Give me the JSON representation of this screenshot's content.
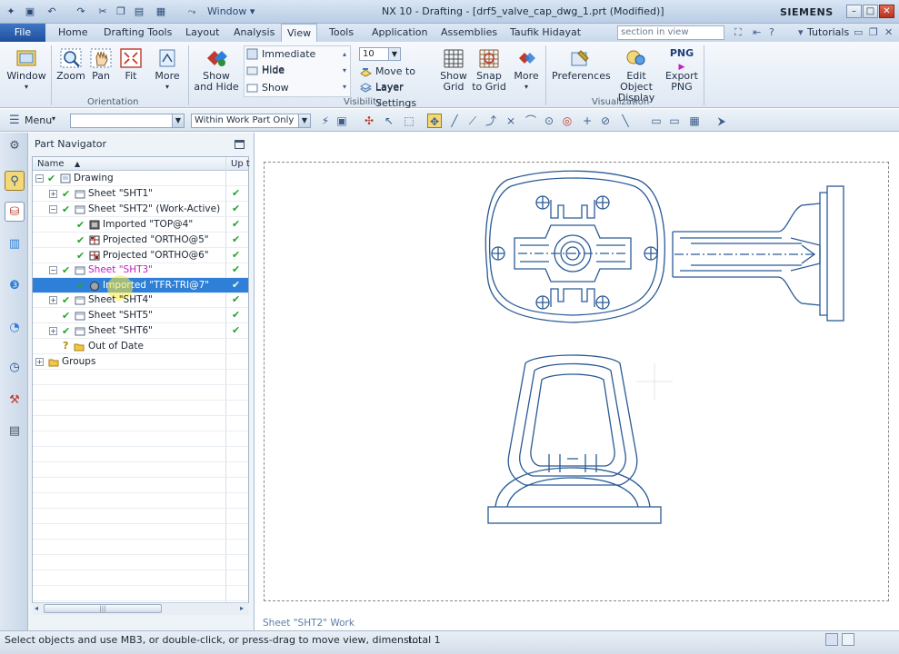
{
  "window": {
    "title": "NX 10 - Drafting - [drf5_valve_cap_dwg_1.prt (Modified)]",
    "brand": "SIEMENS",
    "quick_access_window_label": "Window"
  },
  "tabs": [
    "File",
    "Home",
    "Drafting Tools",
    "Layout",
    "Analysis",
    "View",
    "Tools",
    "Application",
    "Assemblies",
    "Taufik Hidayat"
  ],
  "active_tab": "View",
  "search_placeholder": "section in view",
  "tutorials_label": "Tutorials",
  "ribbon": {
    "window_label": "Window",
    "orientation": {
      "label": "Orientation",
      "zoom": "Zoom",
      "pan": "Pan",
      "fit": "Fit",
      "more": "More"
    },
    "visibility": {
      "label": "Visibility",
      "show_and_hide": "Show and Hide",
      "immediate_hide": "Immediate Hide",
      "hide": "Hide",
      "show": "Show",
      "layer_value": "10",
      "move_to_layer": "Move to Layer",
      "layer_settings": "Layer Settings",
      "show_grid": "Show Grid",
      "snap_to_grid": "Snap to Grid",
      "more": "More"
    },
    "visualization": {
      "label": "Visualization",
      "preferences": "Preferences",
      "edit_object_display": "Edit Object Display",
      "export_png": "Export PNG",
      "png_badge": "PNG"
    }
  },
  "toolbar2": {
    "menu_label": "Menu",
    "filter_value": "",
    "scope_value": "Within Work Part Only"
  },
  "navigator": {
    "title": "Part Navigator",
    "columns": {
      "name": "Name",
      "up": "Up t"
    },
    "rows": [
      {
        "label": "Drawing"
      },
      {
        "label": "Sheet \"SHT1\""
      },
      {
        "label": "Sheet \"SHT2\" (Work-Active)"
      },
      {
        "label": "Imported \"TOP@4\""
      },
      {
        "label": "Projected \"ORTHO@5\""
      },
      {
        "label": "Projected \"ORTHO@6\""
      },
      {
        "label": "Sheet \"SHT3\""
      },
      {
        "label": "Imported \"TFR-TRI@7\""
      },
      {
        "label": "Sheet \"SHT4\""
      },
      {
        "label": "Sheet \"SHT5\""
      },
      {
        "label": "Sheet \"SHT6\""
      },
      {
        "label": "Out of Date"
      },
      {
        "label": "Groups"
      }
    ],
    "colors": {
      "selected_row": "#2e7fd8",
      "sheet_highlight": "#c020c0",
      "check": "#26a32e"
    }
  },
  "drawing": {
    "sheet_label": "Sheet \"SHT2\" Work",
    "line_color": "#2a5a96"
  },
  "status": {
    "message": "Select objects and use MB3, or double-click, or press-drag to move view, dimensi...",
    "total": "total 1"
  }
}
